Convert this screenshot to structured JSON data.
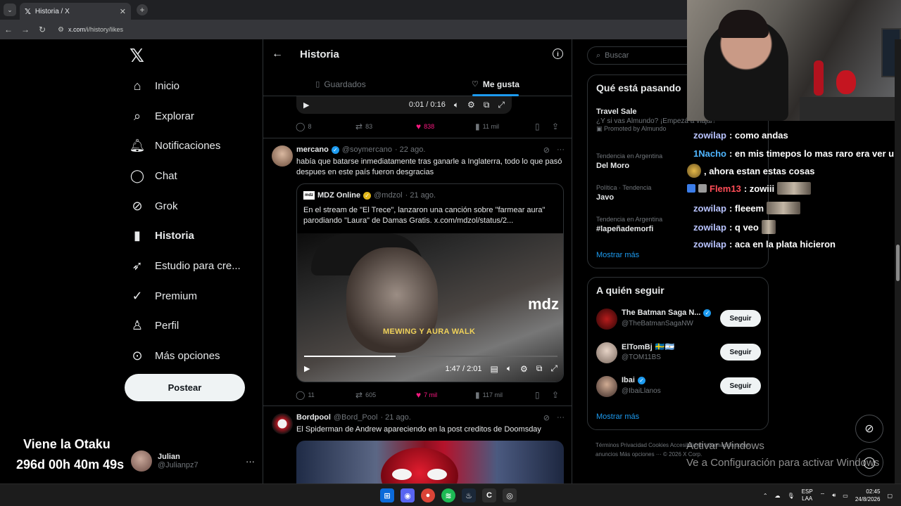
{
  "browser": {
    "tab_title": "Historia / X",
    "url_host": "x.com",
    "url_path": "/i/history/likes"
  },
  "nav": {
    "items": [
      {
        "label": "Inicio",
        "icon": "home-icon"
      },
      {
        "label": "Explorar",
        "icon": "search-icon"
      },
      {
        "label": "Notificaciones",
        "icon": "bell-icon"
      },
      {
        "label": "Chat",
        "icon": "chat-icon"
      },
      {
        "label": "Grok",
        "icon": "grok-icon"
      },
      {
        "label": "Historia",
        "icon": "bookmark-icon"
      },
      {
        "label": "Estudio para cre...",
        "icon": "rocket-icon"
      },
      {
        "label": "Premium",
        "icon": "verified-icon"
      },
      {
        "label": "Perfil",
        "icon": "person-icon"
      },
      {
        "label": "Más opciones",
        "icon": "more-circle-icon"
      }
    ],
    "post_label": "Postear",
    "user_name": "Julian",
    "user_handle": "@Julianpz7"
  },
  "overlay": {
    "otaku": "Viene la Otaku",
    "timer": "296d 00h 40m 49s"
  },
  "main": {
    "title": "Historia",
    "tabs": [
      "Guardados",
      "Me gusta"
    ],
    "top_video_time": "0:01 / 0:16",
    "top_actions": {
      "replies": "8",
      "reposts": "83",
      "likes": "838",
      "views": "11 mil"
    },
    "tweet1": {
      "name": "mercano",
      "handle": "@soymercano",
      "date": "· 22 ago.",
      "text": "había que batarse inmediatamente tras ganarle a Inglaterra, todo lo que pasó despues en este país fueron desgracias",
      "quote_name": "MDZ Online",
      "quote_handle": "@mdzol",
      "quote_date": "· 21 ago.",
      "quote_text": "En el stream de \"El Trece\", lanzaron una canción sobre \"farmear aura\" parodiando \"Laura\" de Damas Gratis. x.com/mdzol/status/2...",
      "logo_text": "mdz",
      "video_caption": "MEWING Y AURA WALK",
      "video_time": "1:47 / 2:01",
      "video_progress": 0.36,
      "actions": {
        "replies": "11",
        "reposts": "605",
        "likes": "7 mil",
        "views": "117 mil"
      }
    },
    "tweet2": {
      "name": "Bordpool",
      "handle": "@Bord_Pool",
      "date": "· 21 ago.",
      "text": "El Spiderman de Andrew apareciendo en la post creditos de Doomsday"
    }
  },
  "right": {
    "search_placeholder": "Buscar",
    "trends_title": "Qué está pasando",
    "promo": {
      "name": "Travel Sale",
      "sub": "¿Y si vas Almundo? ¡Empezá a viajar!",
      "meta": "Promoted by Almundo"
    },
    "trends": [
      {
        "meta": "Tendencia en Argentina",
        "name": "Del Moro"
      },
      {
        "meta": "Política · Tendencia",
        "name": "Javo"
      },
      {
        "meta": "Tendencia en Argentina",
        "name": "#lapeñademorfi"
      }
    ],
    "show_more": "Mostrar más",
    "follow_title": "A quién seguir",
    "follow": [
      {
        "name": "The Batman Saga N...",
        "handle": "@TheBatmanSagaNW",
        "btn": "Seguir"
      },
      {
        "name": "ElTomBj",
        "handle": "@TOM11BS",
        "btn": "Seguir"
      },
      {
        "name": "Ibai",
        "handle": "@IbaiLlanos",
        "btn": "Seguir"
      }
    ],
    "show_more2": "Mostrar más",
    "footer": "Términos   Privacidad   Cookies   Accesibilidad   Información sobre anuncios   Más opciones ···   © 2026 X Corp."
  },
  "chat": [
    {
      "user": "zowilap",
      "msg": ": como andas"
    },
    {
      "user": "1Nacho",
      "msg": ": en mis timepos lo mas raro era ver u"
    },
    {
      "user": "",
      "msg": ", ahora estan estas cosas"
    },
    {
      "user": "Flem13",
      "msg": ": zowiii"
    },
    {
      "user": "zowilap",
      "msg": ": fleeem"
    },
    {
      "user": "zowilap",
      "msg": ": q veo"
    },
    {
      "user": "zowilap",
      "msg": ": aca en la plata hicieron"
    }
  ],
  "windows": {
    "activate_title": "Activar Windows",
    "activate_sub": "Ve a Configuración para activar Windows",
    "lang1": "ESP",
    "lang2": "LAA",
    "time": "02:45",
    "date": "24/8/2026"
  }
}
